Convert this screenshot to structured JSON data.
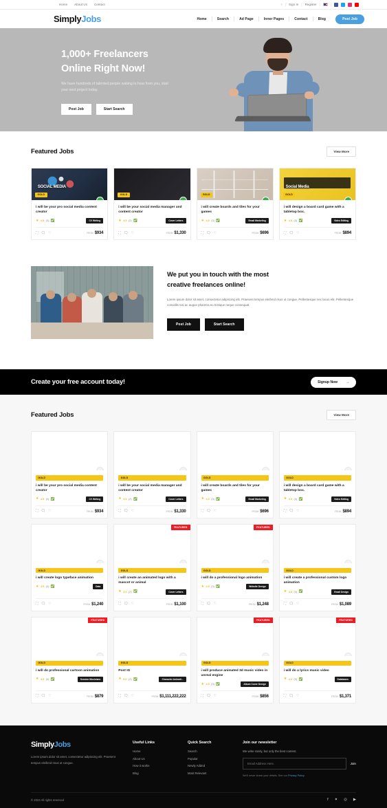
{
  "topbar": {
    "links": [
      {
        "label": "Home"
      },
      {
        "label": "About Us"
      },
      {
        "label": "Contact"
      }
    ],
    "lang": "5",
    "sign_in": "Sign In",
    "register": "Register",
    "separator": "|",
    "socials": [
      {
        "name": "facebook-icon"
      },
      {
        "name": "twitter-icon"
      },
      {
        "name": "instagram-icon"
      },
      {
        "name": "youtube-icon"
      }
    ]
  },
  "header": {
    "logo_bold": "Simply",
    "logo_accent": "Jobs",
    "nav": [
      {
        "label": "Home"
      },
      {
        "label": "Search"
      },
      {
        "label": "Ad Page"
      },
      {
        "label": "Inner Pages"
      },
      {
        "label": "Contact"
      },
      {
        "label": "Blog"
      }
    ],
    "cta_label": "Post Job",
    "accent_color": "#4a9fe0"
  },
  "hero": {
    "title_line1": "1,000+ Freelancers",
    "title_line2": "Online Right Now!",
    "subtitle": "We have hundreds of talented people waiting to hear from you, start your next project today.",
    "primary_button": "Post Job",
    "secondary_button": "Start Search"
  },
  "featured_top": {
    "title": "Featured Jobs",
    "view_more": "View More",
    "cards": [
      {
        "badge": "GOLD",
        "thumb_label": "SOCIAL MEDIA",
        "title": "i will be your pro social media content creator",
        "rating": "4.5",
        "reviews": "(3)",
        "tag": "CV Writing",
        "from": "FROM",
        "price": "$934"
      },
      {
        "badge": "GOLD",
        "thumb_label": "",
        "title": "i will be your social media manager and content creator",
        "rating": "4.5",
        "reviews": "(2)",
        "tag": "Cover Letters",
        "from": "FROM",
        "price": "$1,330"
      },
      {
        "badge": "GOLD",
        "thumb_label": "",
        "title": "i will create boards and tiles for your games",
        "rating": "4.5",
        "reviews": "(3)",
        "tag": "Email Marketing",
        "from": "FROM",
        "price": "$696"
      },
      {
        "badge": "GOLD",
        "thumb_label": "Social Media",
        "title": "i will design a board card game with a tabletop box.",
        "rating": "4.5",
        "reviews": "(3)",
        "tag": "Video Editing",
        "from": "FROM",
        "price": "$894"
      }
    ]
  },
  "about": {
    "heading_line1": "We put you in touch with the most",
    "heading_line2": "creative freelances online!",
    "body": "Lorem ipsum dolor sit amet, consectetur adipiscing elit. Praesent tempus eleifend risus ut congue. Pellentesque nec lacus elit. Pellentesque convallis nisi ac augue pharetra eu tristique neque consequat.",
    "primary_button": "Post Job",
    "secondary_button": "Start Search"
  },
  "cta": {
    "title": "Create your free account today!",
    "button": "Signup Now",
    "arrow": "→"
  },
  "featured_bottom": {
    "title": "Featured Jobs",
    "view_more": "View More",
    "rows": [
      [
        {
          "badge": "GOLD",
          "featured": "",
          "title": "i will be your pro social media content creator",
          "rating": "4.5",
          "reviews": "(3)",
          "tag": "CV Writing",
          "from": "FROM",
          "price": "$934"
        },
        {
          "badge": "GOLD",
          "featured": "",
          "title": "i will be your social media manager and content creator",
          "rating": "4.5",
          "reviews": "(2)",
          "tag": "Cover Letters",
          "from": "FROM",
          "price": "$1,330"
        },
        {
          "badge": "GOLD",
          "featured": "",
          "title": "i will create boards and tiles for your games",
          "rating": "4.5",
          "reviews": "(3)",
          "tag": "Email Marketing",
          "from": "FROM",
          "price": "$696"
        },
        {
          "badge": "GOLD",
          "featured": "",
          "title": "i will design a board card game with a tabletop box.",
          "rating": "4.5",
          "reviews": "(3)",
          "tag": "Video Editing",
          "from": "FROM",
          "price": "$894"
        }
      ],
      [
        {
          "badge": "GOLD",
          "featured": "",
          "title": "i will create logo typeface animation",
          "rating": "4.5",
          "reviews": "(3)",
          "tag": "Data",
          "from": "FROM",
          "price": "$1,240"
        },
        {
          "badge": "GOLD",
          "featured": "FEATURED",
          "title": "i will create an animated logo with a mascot or animal",
          "rating": "4.5",
          "reviews": "(2)",
          "tag": "Cover Letters",
          "from": "FROM",
          "price": "$1,100"
        },
        {
          "badge": "GOLD",
          "featured": "FEATURED",
          "title": "i will do a professional logo animation",
          "rating": "4.5",
          "reviews": "(3)",
          "tag": "Website Design",
          "from": "FROM",
          "price": "$1,248"
        },
        {
          "badge": "GOLD",
          "featured": "",
          "title": "i will create a professional custom logo animation",
          "rating": "4.5",
          "reviews": "(3)",
          "tag": "Email Design",
          "from": "FROM",
          "price": "$1,089"
        }
      ],
      [
        {
          "badge": "GOLD",
          "featured": "FEATURED",
          "title": "i will do professional cartoon animation",
          "rating": "4.5",
          "reviews": "(3)",
          "tag": "Session Musicians",
          "from": "FROM",
          "price": "$879"
        },
        {
          "badge": "GOLD",
          "featured": "",
          "title": "Post IG",
          "rating": "5.0",
          "reviews": "(2)",
          "tag": "Character Animati...",
          "from": "FROM",
          "price": "$1,111,222,222"
        },
        {
          "badge": "GOLD",
          "featured": "FEATURED",
          "title": "i will produce animated 3d music video in unreal engine",
          "rating": "4.5",
          "reviews": "(3)",
          "tag": "Album Cover Design",
          "from": "FROM",
          "price": "$856"
        },
        {
          "badge": "GOLD",
          "featured": "FEATURED",
          "title": "i will do a lyrics music video",
          "rating": "4.0",
          "reviews": "(3)",
          "tag": "Databases",
          "from": "FROM",
          "price": "$1,371"
        }
      ]
    ]
  },
  "footer": {
    "logo_bold": "Simply",
    "logo_accent": "Jobs",
    "description": "Lorem ipsum dolor sit amet, consectetur adipiscing elit. Praesent tempus eleifend risus ut congue.",
    "useful_links_title": "Useful Links",
    "useful_links": [
      {
        "label": "Home"
      },
      {
        "label": "About Us"
      },
      {
        "label": "How it works"
      },
      {
        "label": "Blog"
      }
    ],
    "quick_search_title": "Quick Search",
    "quick_search": [
      {
        "label": "Search"
      },
      {
        "label": "Popular"
      },
      {
        "label": "Newly Added"
      },
      {
        "label": "Most Relevant"
      }
    ],
    "newsletter_title": "Join our newsletter",
    "newsletter_sub": "We write rarely, but only the best content.",
    "email_placeholder": "Email Address Here.",
    "join_label": "Join",
    "fine_print": "We'll never share your details. See our ",
    "privacy_link": "Privacy Policy",
    "copyright": "© 2023 All rights reserved",
    "socials": [
      {
        "name": "facebook-icon",
        "glyph": "f"
      },
      {
        "name": "twitter-icon",
        "glyph": "✦"
      },
      {
        "name": "instagram-icon",
        "glyph": "◎"
      },
      {
        "name": "youtube-icon",
        "glyph": "▶"
      }
    ]
  },
  "icons": {
    "star": "★",
    "verified": "✅",
    "compare": "⛶",
    "chat": "🗨",
    "heart": "♡"
  }
}
